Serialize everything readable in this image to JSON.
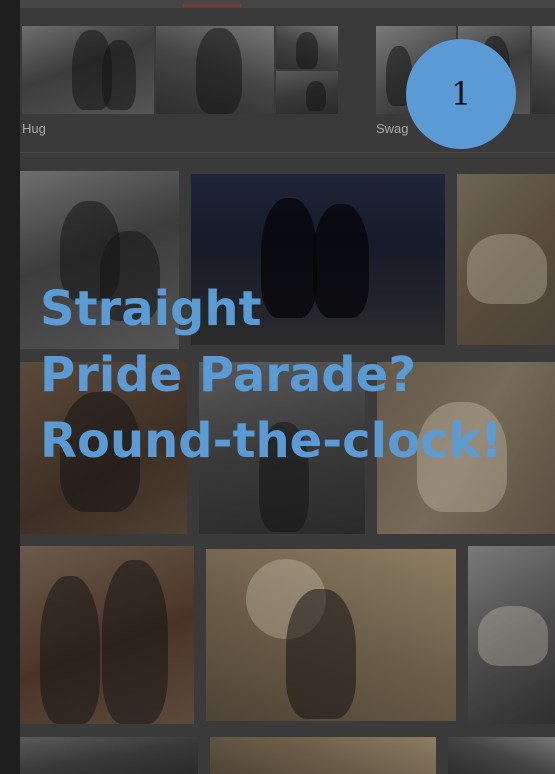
{
  "categories": [
    {
      "label": "Hug"
    },
    {
      "label": "Swag"
    }
  ],
  "badge": {
    "number": "1"
  },
  "headline": {
    "lines": [
      "Straight",
      "Pride Parade?",
      "Round-the-clock!"
    ]
  },
  "colors": {
    "badge": "#5b9bd5",
    "headline": "#5b9bd5",
    "overlay": "#3a3a3a"
  }
}
